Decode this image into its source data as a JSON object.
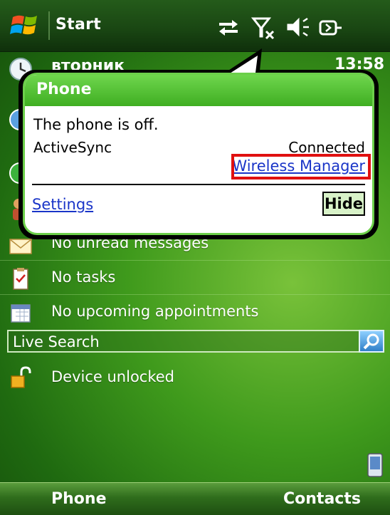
{
  "titlebar": {
    "start_label": "Start"
  },
  "today": {
    "date_label": "вторник",
    "time": "13:58",
    "messages_label": "No unread messages",
    "tasks_label": "No tasks",
    "appointments_label": "No upcoming appointments",
    "search_label": "Live Search",
    "lock_label": "Device unlocked"
  },
  "notification": {
    "title": "Phone",
    "message": "The phone is off.",
    "activesync_label": "ActiveSync",
    "activesync_status": "Connected",
    "wireless_manager_link": "Wireless Manager",
    "settings_link": "Settings",
    "hide_button": "Hide"
  },
  "softkeys": {
    "left": "Phone",
    "right": "Contacts"
  },
  "colors": {
    "accent_green": "#3fae22",
    "highlight_red": "#e01010",
    "link_blue": "#1a35c8"
  }
}
